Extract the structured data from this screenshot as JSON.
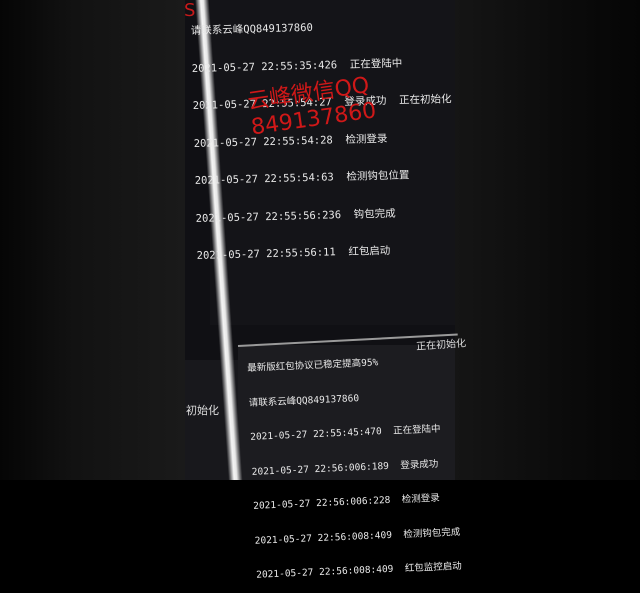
{
  "watermark": {
    "line1": "云峰微信QQ",
    "line2": "849137860"
  },
  "top_log": {
    "lines": [
      "2021-05-27 22:55:35:426  正在登陆中",
      "2021-05-27 22:55:54:27  登录成功  正在初始化",
      "2021-05-27 22:55:54:28  检测登录",
      "2021-05-27 22:55:54:63  检测钩包位置",
      "2021-05-27 22:55:56:236  钩包完成",
      "2021-05-27 22:55:56:11  红包启动"
    ],
    "header": "请联系云峰QQ849137860"
  },
  "bottom_log": {
    "header1": "最新版红包协议已稳定提高95%",
    "header2": "请联系云峰QQ849137860",
    "lines": [
      "2021-05-27 22:55:45:470  正在登陆中",
      "2021-05-27 22:56:006:189  登录成功",
      "2021-05-27 22:56:006:228  检测登录",
      "2021-05-27 22:56:008:409  检测钩包完成",
      "2021-05-27 22:56:008:409  红包监控启动"
    ],
    "side_status": "正在初始化"
  },
  "left_fragment": "初始化"
}
